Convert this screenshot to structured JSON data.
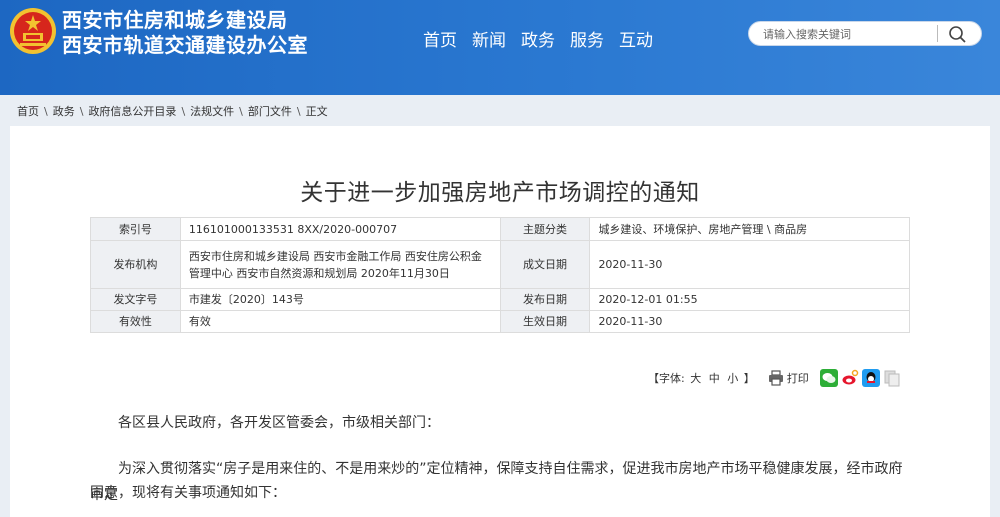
{
  "header": {
    "title_line1": "西安市住房和城乡建设局",
    "title_line2": "西安市轨道交通建设办公室",
    "nav": [
      "首页",
      "新闻",
      "政务",
      "服务",
      "互动"
    ],
    "search_placeholder": "请输入搜索关键词",
    "colors": {
      "accent": "#2a78d1",
      "emblem": "#d6261c",
      "emblem_gold": "#f2c230"
    }
  },
  "breadcrumb": [
    "首页",
    "政务",
    "政府信息公开目录",
    "法规文件",
    "部门文件",
    "正文"
  ],
  "breadcrumb_sep": "\\",
  "document": {
    "title": "关于进一步加强房地产市场调控的通知",
    "meta": {
      "index_label": "索引号",
      "index_value": "116101000133531 8XX/2020-000707",
      "topic_label": "主题分类",
      "topic_value": "城乡建设、环境保护、房地产管理 \\ 商品房",
      "publisher_label": "发布机构",
      "publisher_value": "西安市住房和城乡建设局 西安市金融工作局 西安住房公积金管理中心 西安市自然资源和规划局 2020年11月30日",
      "written_label": "成文日期",
      "written_value": "2020-11-30",
      "docno_label": "发文字号",
      "docno_value": "市建发〔2020〕143号",
      "pubdate_label": "发布日期",
      "pubdate_value": "2020-12-01 01:55",
      "validity_label": "有效性",
      "validity_value": "有效",
      "effective_label": "生效日期",
      "effective_value": "2020-11-30"
    },
    "toolbar": {
      "font_prefix": "【字体:",
      "sizes": [
        "大",
        "中",
        "小"
      ],
      "font_suffix": "】",
      "print_label": "打印"
    },
    "greeting": "各区县人民政府，各开发区管委会，市级相关部门：",
    "para1_line1": "为深入贯彻落实“房子是用来住的、不是用来炒的”定位精神，保障支持自住需求，促进我市房地产市场平稳健康发展，经市政府审定",
    "para1_line2": "同意，现将有关事项通知如下："
  }
}
